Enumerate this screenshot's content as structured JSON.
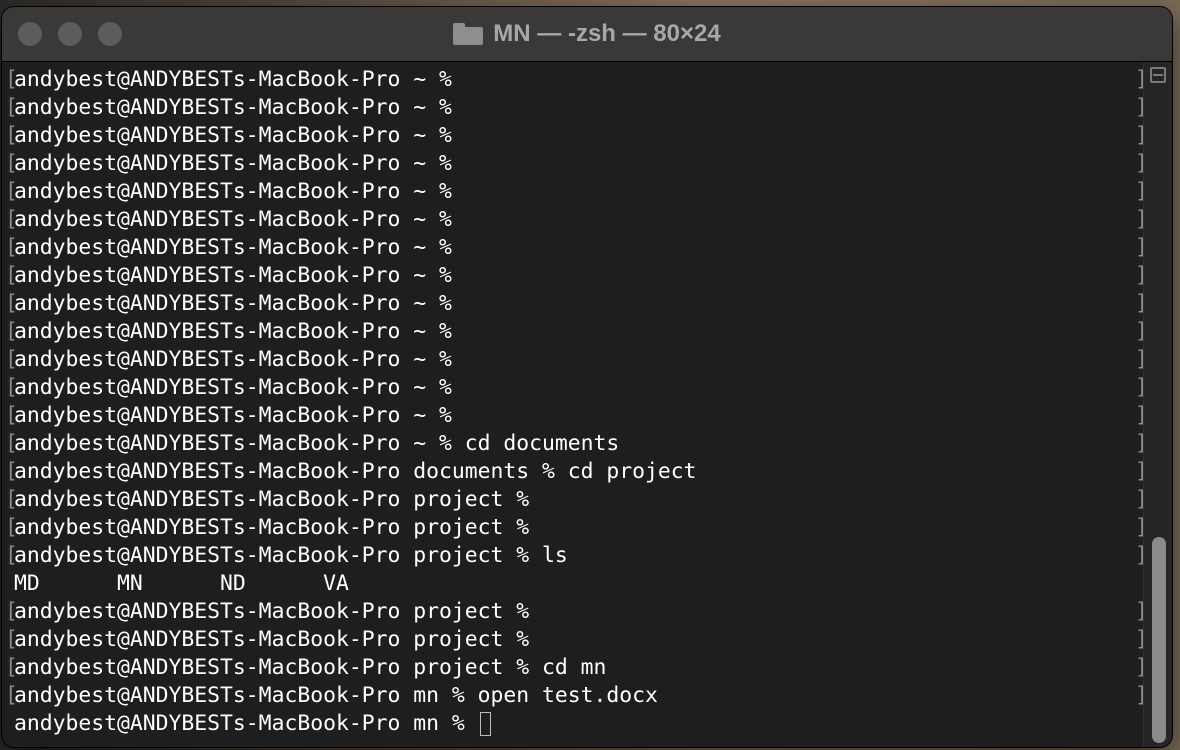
{
  "window": {
    "title": "MN — -zsh — 80×24",
    "icon": "folder-icon"
  },
  "terminal": {
    "lines": [
      {
        "text": "andybest@ANDYBESTs-MacBook-Pro ~ %",
        "marked": true
      },
      {
        "text": "andybest@ANDYBESTs-MacBook-Pro ~ %",
        "marked": true
      },
      {
        "text": "andybest@ANDYBESTs-MacBook-Pro ~ %",
        "marked": true
      },
      {
        "text": "andybest@ANDYBESTs-MacBook-Pro ~ %",
        "marked": true
      },
      {
        "text": "andybest@ANDYBESTs-MacBook-Pro ~ %",
        "marked": true
      },
      {
        "text": "andybest@ANDYBESTs-MacBook-Pro ~ %",
        "marked": true
      },
      {
        "text": "andybest@ANDYBESTs-MacBook-Pro ~ %",
        "marked": true
      },
      {
        "text": "andybest@ANDYBESTs-MacBook-Pro ~ %",
        "marked": true
      },
      {
        "text": "andybest@ANDYBESTs-MacBook-Pro ~ %",
        "marked": true
      },
      {
        "text": "andybest@ANDYBESTs-MacBook-Pro ~ %",
        "marked": true
      },
      {
        "text": "andybest@ANDYBESTs-MacBook-Pro ~ %",
        "marked": true
      },
      {
        "text": "andybest@ANDYBESTs-MacBook-Pro ~ %",
        "marked": true
      },
      {
        "text": "andybest@ANDYBESTs-MacBook-Pro ~ %",
        "marked": true
      },
      {
        "text": "andybest@ANDYBESTs-MacBook-Pro ~ % cd documents",
        "marked": true
      },
      {
        "text": "andybest@ANDYBESTs-MacBook-Pro documents % cd project",
        "marked": true
      },
      {
        "text": "andybest@ANDYBESTs-MacBook-Pro project %",
        "marked": true
      },
      {
        "text": "andybest@ANDYBESTs-MacBook-Pro project %",
        "marked": true
      },
      {
        "text": "andybest@ANDYBESTs-MacBook-Pro project % ls",
        "marked": true
      },
      {
        "text": "MD      MN      ND      VA",
        "marked": false
      },
      {
        "text": "andybest@ANDYBESTs-MacBook-Pro project %",
        "marked": true
      },
      {
        "text": "andybest@ANDYBESTs-MacBook-Pro project %",
        "marked": true
      },
      {
        "text": "andybest@ANDYBESTs-MacBook-Pro project % cd mn",
        "marked": true
      },
      {
        "text": "andybest@ANDYBESTs-MacBook-Pro mn % open test.docx",
        "marked": true
      }
    ],
    "current_prompt": "andybest@ANDYBESTs-MacBook-Pro mn % "
  },
  "colors": {
    "background": "#1e1e1e",
    "foreground": "#ffffff",
    "titlebar": "#3a3938",
    "mark_bracket": "#8a8a8a"
  }
}
